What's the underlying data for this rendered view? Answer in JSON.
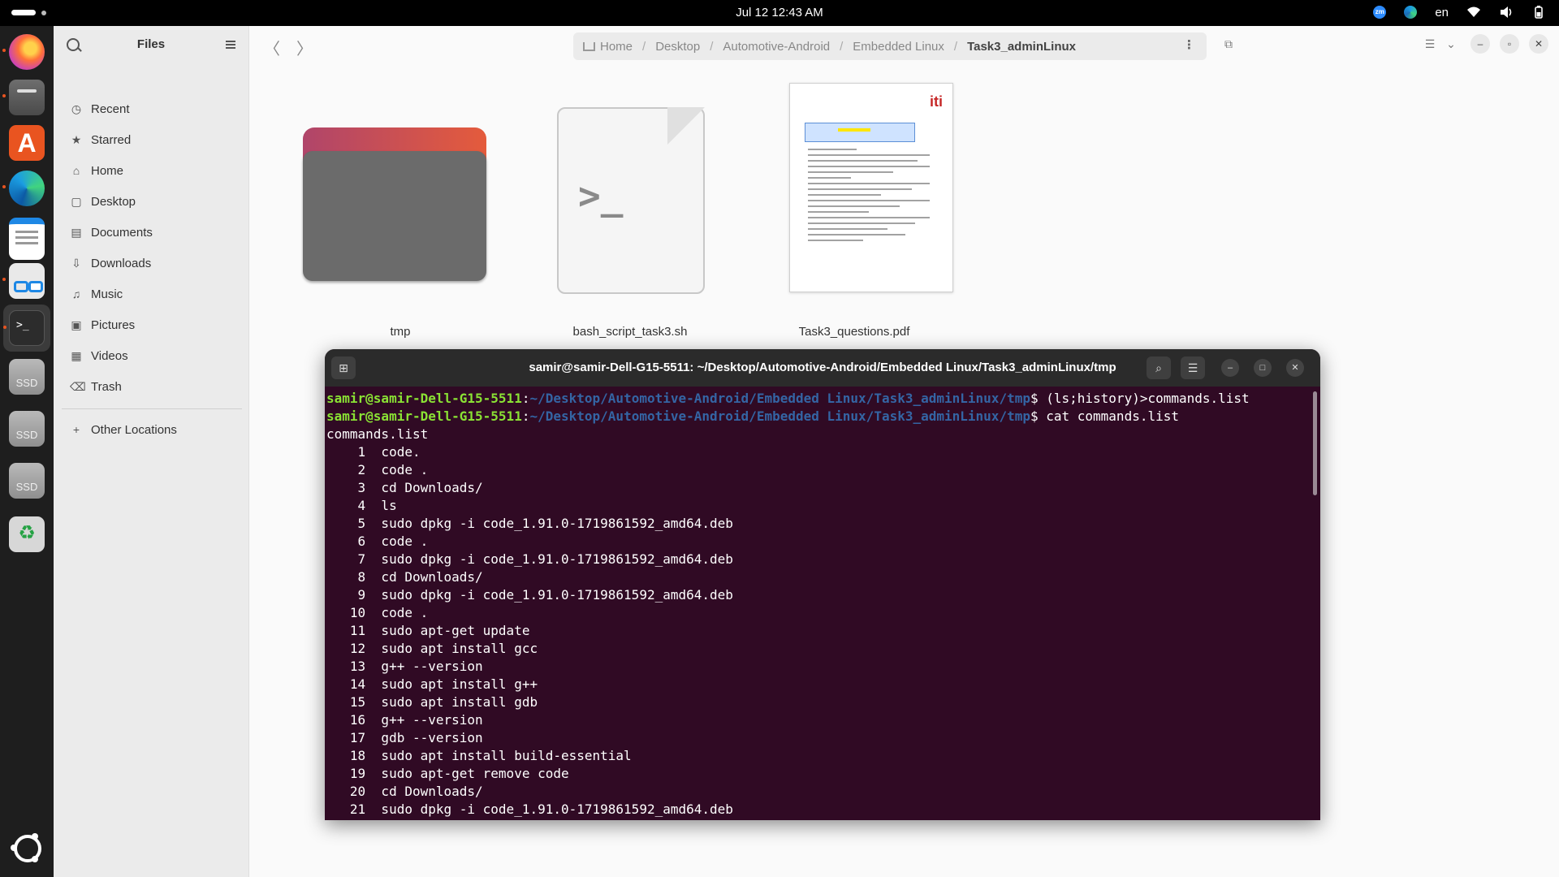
{
  "topbar": {
    "clock": "Jul 12  12:43 AM",
    "lang": "en",
    "zoom_label": "zm"
  },
  "dock": {
    "items": [
      "Firefox",
      "Files",
      "App Center",
      "Microsoft Edge",
      "Text Editor",
      "Document Viewer",
      "Terminal",
      "SSD",
      "SSD",
      "SSD",
      "Trash",
      "Show Apps"
    ],
    "ssd_label": "SSD",
    "terminal_glyph": ">_"
  },
  "files": {
    "sidebar_title": "Files",
    "sidebar_items": [
      {
        "label": "Recent",
        "icon": "clock-icon"
      },
      {
        "label": "Starred",
        "icon": "star-icon"
      },
      {
        "label": "Home",
        "icon": "home-icon"
      },
      {
        "label": "Desktop",
        "icon": "desktop-icon"
      },
      {
        "label": "Documents",
        "icon": "document-icon"
      },
      {
        "label": "Downloads",
        "icon": "download-icon"
      },
      {
        "label": "Music",
        "icon": "music-icon"
      },
      {
        "label": "Pictures",
        "icon": "picture-icon"
      },
      {
        "label": "Videos",
        "icon": "video-icon"
      },
      {
        "label": "Trash",
        "icon": "trash-icon"
      }
    ],
    "other_locations": "Other Locations",
    "breadcrumbs": [
      "Home",
      "Desktop",
      "Automotive-Android",
      "Embedded Linux",
      "Task3_adminLinux"
    ],
    "items": [
      {
        "name": "tmp",
        "type": "folder"
      },
      {
        "name": "bash_script_task3.sh",
        "type": "script"
      },
      {
        "name": "Task3_questions.pdf",
        "type": "pdf"
      }
    ]
  },
  "terminal": {
    "title": "samir@samir-Dell-G15-5511: ~/Desktop/Automotive-Android/Embedded Linux/Task3_adminLinux/tmp",
    "prompt_user": "samir@samir-Dell-G15-5511",
    "prompt_path": "~/Desktop/Automotive-Android/Embedded Linux/Task3_adminLinux/tmp",
    "cmd1": "$ (ls;history)>commands.list",
    "cmd2": "$ cat commands.list",
    "output": "commands.list\n    1  code.\n    2  code .\n    3  cd Downloads/\n    4  ls\n    5  sudo dpkg -i code_1.91.0-1719861592_amd64.deb\n    6  code .\n    7  sudo dpkg -i code_1.91.0-1719861592_amd64.deb\n    8  cd Downloads/\n    9  sudo dpkg -i code_1.91.0-1719861592_amd64.deb\n   10  code .\n   11  sudo apt-get update\n   12  sudo apt install gcc\n   13  g++ --version\n   14  sudo apt install g++\n   15  sudo apt install gdb\n   16  g++ --version\n   17  gdb --version\n   18  sudo apt install build-essential\n   19  sudo apt-get remove code\n   20  cd Downloads/\n   21  sudo dpkg -i code_1.91.0-1719861592_amd64.deb"
  }
}
